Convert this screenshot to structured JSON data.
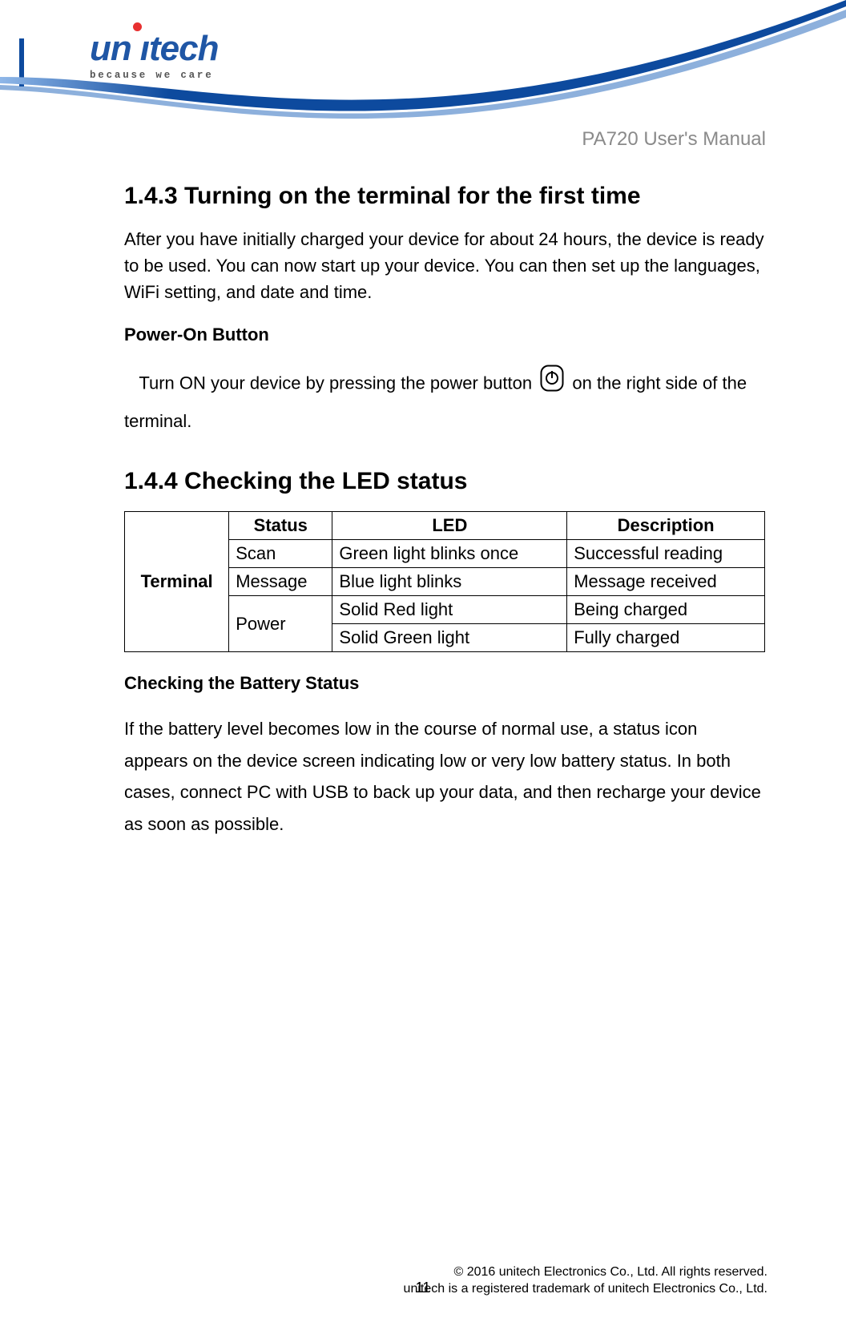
{
  "brand": {
    "name": "unitech",
    "tagline": "because we care"
  },
  "doc_title": "PA720 User's Manual",
  "section_1_4_3": {
    "heading": "1.4.3 Turning on the terminal for the first time",
    "intro": "After you have initially charged your device for about 24 hours, the device is ready to be used. You can now start up your device. You can then set up the languages, WiFi setting, and date and time.",
    "power_on_label": "Power-On Button",
    "power_on_text_a": "Turn ON your device by pressing the power button ",
    "power_on_text_b": " on the right side of the terminal."
  },
  "section_1_4_4": {
    "heading": "1.4.4 Checking the LED status"
  },
  "led_table": {
    "rowhdr": "Terminal",
    "cols": {
      "status": "Status",
      "led": "LED",
      "desc": "Description"
    },
    "rows": [
      {
        "status": "Scan",
        "led": "Green light blinks once",
        "desc": "Successful reading"
      },
      {
        "status": "Message",
        "led": "Blue light blinks",
        "desc": "Message received"
      },
      {
        "status": "Power",
        "led": "Solid Red light",
        "desc": "Being charged"
      },
      {
        "status": "",
        "led": "Solid Green light",
        "desc": "Fully charged"
      }
    ]
  },
  "battery": {
    "heading": "Checking the Battery Status",
    "text": "If the battery level becomes low in the course of normal use, a status icon appears on the device screen indicating low or very low battery status. In both cases, connect PC with USB to back up your data, and then recharge your device as soon as possible."
  },
  "footer": {
    "page_number": "11",
    "copyright1": "© 2016 unitech Electronics Co., Ltd. All rights reserved.",
    "copyright2": "unitech is a registered trademark of unitech Electronics Co., Ltd."
  }
}
